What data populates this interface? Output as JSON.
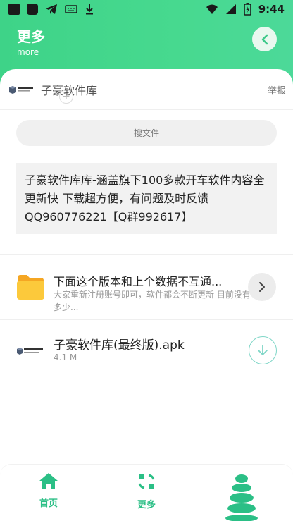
{
  "status_bar": {
    "time": "9:44"
  },
  "header": {
    "title": "更多",
    "subtitle": "more"
  },
  "library": {
    "name": "子豪软件库",
    "report_label": "举报"
  },
  "search": {
    "label": "搜文件"
  },
  "notice": {
    "text": "子豪软件库库-涵盖旗下100多款开车软件内容全 更新快 下载超方便，有问题及时反馈QQ960776221【Q群992617】"
  },
  "items": [
    {
      "title": "下面这个版本和上个数据不互通...",
      "description": "大家重新注册账号即可，软件都会不断更新 目前没有多少..."
    }
  ],
  "files": [
    {
      "name": "子豪软件库(最终版).apk",
      "size": "4.1 M"
    }
  ],
  "tabbar": {
    "home_label": "首页",
    "more_label": "更多"
  },
  "colors": {
    "accent": "#3ed388",
    "tab_accent": "#2bbf86",
    "download_ring": "#7fd6c7"
  }
}
